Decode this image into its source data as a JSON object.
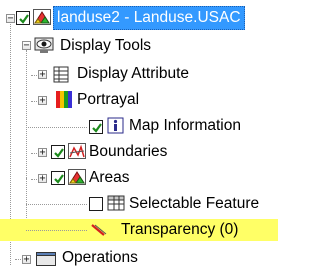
{
  "tree": {
    "layer": {
      "label": "landuse2 - Landuse.USAC",
      "checked": true,
      "icon": "polygon-layer-icon"
    },
    "display_tools": {
      "label": "Display Tools",
      "icon": "display-tools-icon"
    },
    "items": [
      {
        "id": "display-attribute",
        "label": "Display Attribute",
        "icon": "table-icon",
        "expandable": true,
        "checkbox": false
      },
      {
        "id": "portrayal",
        "label": "Portrayal",
        "icon": "color-bars-icon",
        "expandable": true,
        "checkbox": false
      },
      {
        "id": "map-information",
        "label": "Map Information",
        "icon": "info-icon",
        "expandable": false,
        "checkbox": true,
        "checked": true
      },
      {
        "id": "boundaries",
        "label": "Boundaries",
        "icon": "boundaries-icon",
        "expandable": true,
        "checkbox": true,
        "checked": true
      },
      {
        "id": "areas",
        "label": "Areas",
        "icon": "areas-icon",
        "expandable": true,
        "checkbox": true,
        "checked": true
      },
      {
        "id": "selectable-features",
        "label": "Selectable Feature",
        "icon": "selectable-table-icon",
        "expandable": false,
        "checkbox": true,
        "checked": false
      },
      {
        "id": "transparency",
        "label": "Transparency (0)",
        "icon": "transparency-icon",
        "expandable": false,
        "checkbox": false,
        "highlighted": true
      }
    ],
    "operations": {
      "label": "Operations",
      "icon": "operations-icon"
    }
  },
  "colors": {
    "selection": "#3399ff",
    "highlight": "#ffff66",
    "check": "#1c8a1c"
  }
}
